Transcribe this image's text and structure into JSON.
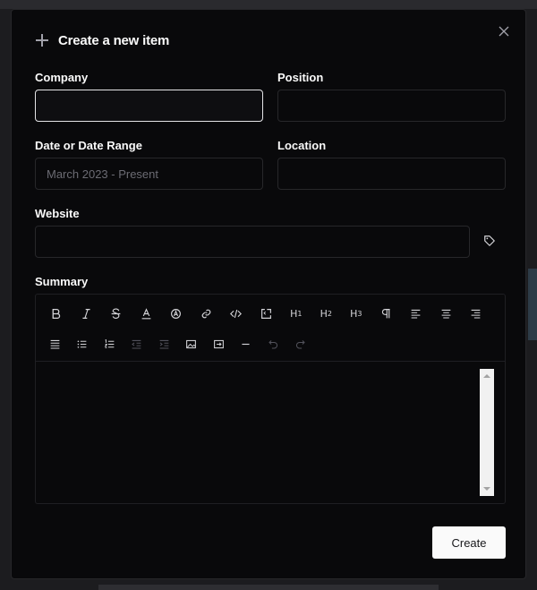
{
  "dialog": {
    "title": "Create a new item",
    "icons": {
      "header": "plus-icon",
      "close": "close-icon",
      "website_action": "tag-icon"
    }
  },
  "form": {
    "company": {
      "label": "Company",
      "value": "",
      "placeholder": ""
    },
    "position": {
      "label": "Position",
      "value": "",
      "placeholder": ""
    },
    "date": {
      "label": "Date or Date Range",
      "value": "",
      "placeholder": "March 2023 - Present"
    },
    "location": {
      "label": "Location",
      "value": "",
      "placeholder": ""
    },
    "website": {
      "label": "Website",
      "value": "",
      "placeholder": ""
    },
    "summary": {
      "label": "Summary"
    }
  },
  "toolbar": {
    "h1": "H",
    "h1_sub": "1",
    "h2": "H",
    "h2_sub": "2",
    "h3": "H",
    "h3_sub": "3"
  },
  "actions": {
    "create_label": "Create"
  },
  "colors": {
    "background": "#09090b",
    "border": "#27272a",
    "text": "#fafafa",
    "muted": "#6b6b73",
    "button_bg": "#fafafa"
  }
}
